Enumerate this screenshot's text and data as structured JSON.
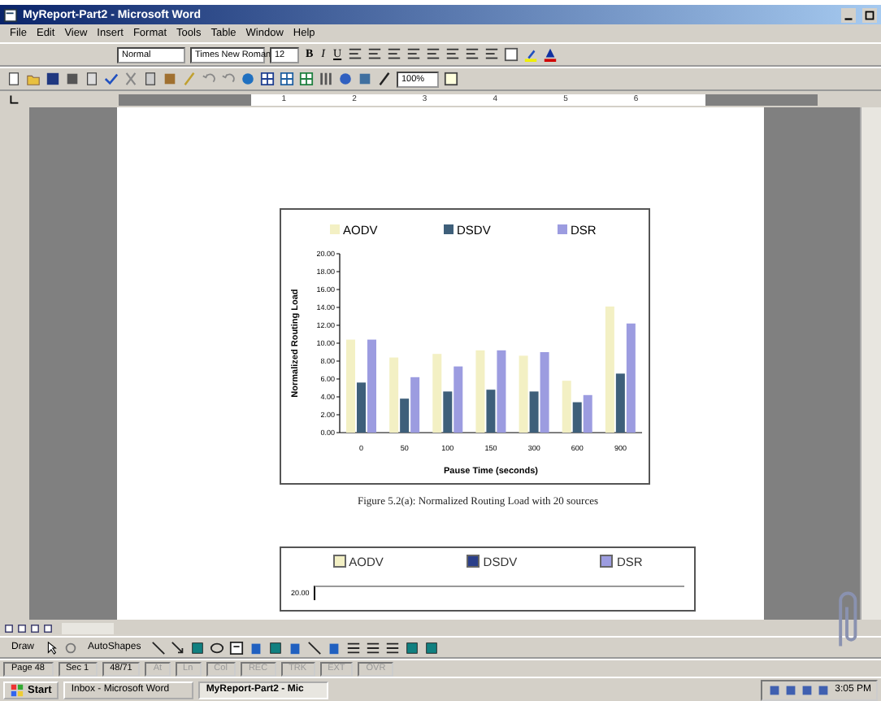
{
  "window": {
    "title": "MyReport-Part2 - Microsoft Word"
  },
  "menu": [
    "File",
    "Edit",
    "View",
    "Insert",
    "Format",
    "Tools",
    "Table",
    "Window",
    "Help"
  ],
  "formatting_toolbar": {
    "style": "Normal",
    "font": "Times New Roman",
    "size": "12",
    "bold": "B",
    "italic": "I",
    "underline": "U"
  },
  "standard_toolbar": {
    "zoom": "100%"
  },
  "ruler": {
    "numbers": [
      "1",
      "2",
      "3",
      "4",
      "5",
      "6"
    ]
  },
  "document": {
    "figure": {
      "chart_data": {
        "type": "bar",
        "xlabel": "Pause Time (seconds)",
        "ylabel": "Normalized Routing Load",
        "categories": [
          "0",
          "50",
          "100",
          "150",
          "300",
          "600",
          "900"
        ],
        "series": [
          {
            "name": "AODV",
            "color": "#f3f0c4",
            "values": [
              10.4,
              8.4,
              8.8,
              9.2,
              8.6,
              5.8,
              14.1
            ]
          },
          {
            "name": "DSDV",
            "color": "#3e5f7a",
            "values": [
              5.6,
              3.8,
              4.6,
              4.8,
              4.6,
              3.4,
              6.6
            ]
          },
          {
            "name": "DSR",
            "color": "#9c9ce0",
            "values": [
              10.4,
              6.2,
              7.4,
              9.2,
              9.0,
              4.2,
              12.2
            ]
          }
        ],
        "legend": true,
        "ylim": [
          0,
          20
        ],
        "yticks": [
          {
            "value": 0,
            "label": "0.00"
          },
          {
            "value": 2,
            "label": "2.00"
          },
          {
            "value": 4,
            "label": "4.00"
          },
          {
            "value": 6,
            "label": "6.00"
          },
          {
            "value": 8,
            "label": "8.00"
          },
          {
            "value": 10,
            "label": "10.00"
          },
          {
            "value": 12,
            "label": "12.00"
          },
          {
            "value": 14,
            "label": "14.00"
          },
          {
            "value": 16,
            "label": "16.00"
          },
          {
            "value": 18,
            "label": "18.00"
          },
          {
            "value": 20,
            "label": "20.00"
          }
        ]
      }
    },
    "caption": "Figure 5.2(a):  Normalized Routing Load with 20 sources",
    "figure_2": {
      "legend": [
        {
          "name": "AODV",
          "color": "#f3f0c4"
        },
        {
          "name": "DSDV",
          "color": "#2a3f8a"
        },
        {
          "name": "DSR",
          "color": "#9c9ce0"
        }
      ],
      "ytick": "20.00"
    }
  },
  "draw_toolbar": {
    "draw": "Draw",
    "autoshapes": "AutoShapes"
  },
  "status_bar": [
    {
      "text": "Page 48",
      "disabled": false
    },
    {
      "text": "Sec 1",
      "disabled": false
    },
    {
      "text": "48/71",
      "disabled": false
    },
    {
      "text": "At",
      "disabled": true
    },
    {
      "text": "Ln",
      "disabled": true
    },
    {
      "text": "Col",
      "disabled": true
    },
    {
      "text": "REC",
      "disabled": true
    },
    {
      "text": "TRK",
      "disabled": true
    },
    {
      "text": "EXT",
      "disabled": true
    },
    {
      "text": "OVR",
      "disabled": true
    }
  ],
  "taskbar": {
    "start": "Start",
    "tasks": [
      {
        "label": "Inbox - Microsoft Word",
        "selected": false
      },
      {
        "label": "MyReport-Part2 - Mic",
        "selected": true
      }
    ],
    "clock": "3:05 PM"
  }
}
